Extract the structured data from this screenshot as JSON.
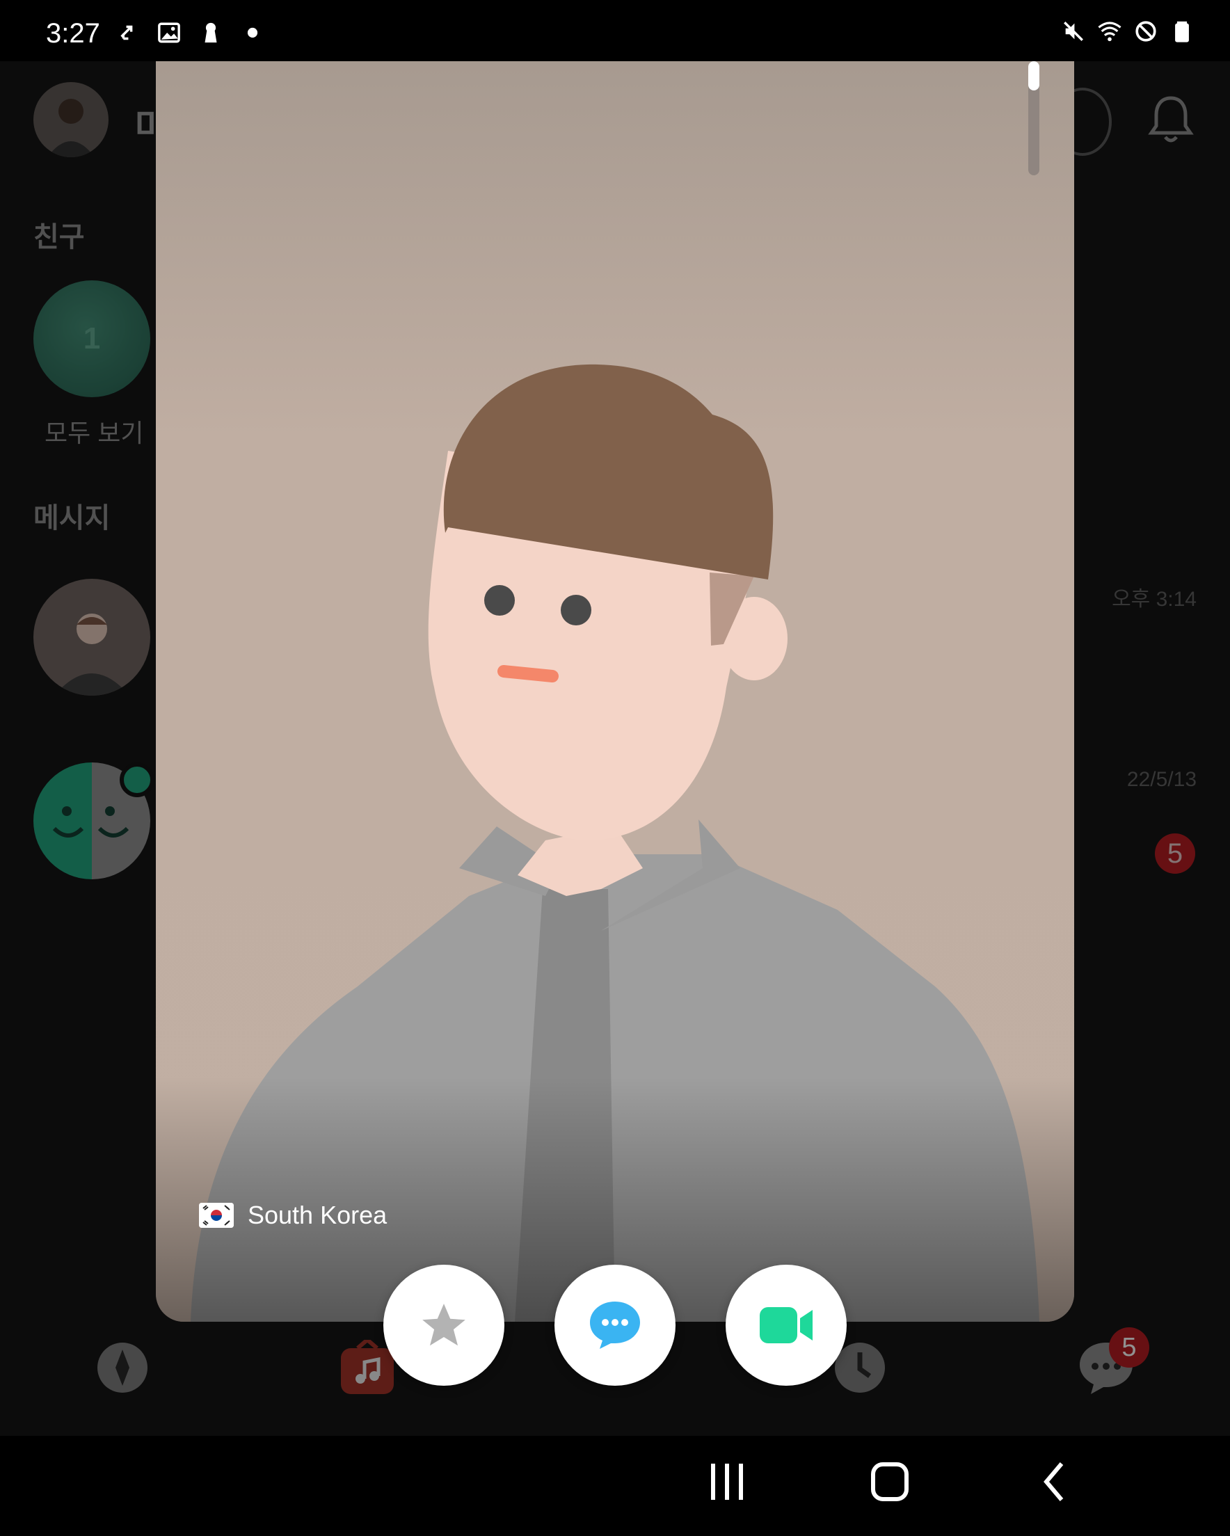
{
  "status_bar": {
    "time": "3:27",
    "left_icons": [
      "sync-icon",
      "image-icon",
      "keyhole-icon",
      "dot-icon"
    ],
    "right_icons": [
      "mute-icon",
      "wifi-icon",
      "block-icon",
      "battery-icon"
    ]
  },
  "background_app": {
    "title_fragment": "마",
    "friends_section": "친구",
    "friends_count": "1",
    "all_view_label": "모두 보기",
    "messages_section": "메시지",
    "messages": [
      {
        "time": "오후 3:14"
      },
      {
        "time": "22/5/13",
        "unread": "5"
      }
    ],
    "bottom_nav_badge": "5"
  },
  "profile_card": {
    "country": "South Korea"
  },
  "actions": {
    "favorite": "star-icon",
    "message": "chat-icon",
    "video": "video-call-icon"
  },
  "colors": {
    "accent_green": "#1ed89a",
    "chat_blue": "#3ab4f2",
    "badge_red": "#b3151a"
  }
}
